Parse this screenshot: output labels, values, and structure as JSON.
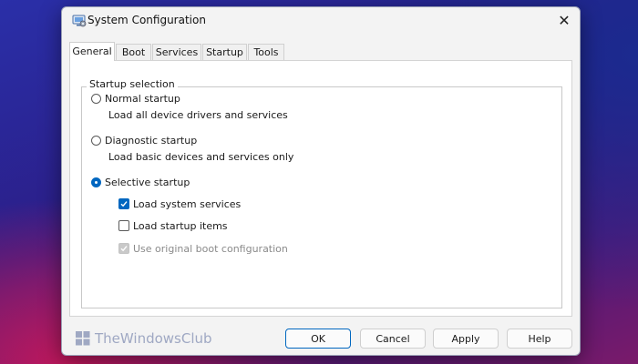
{
  "window": {
    "title": "System Configuration",
    "close_glyph": "✕"
  },
  "tabs": [
    {
      "label": "General",
      "active": true
    },
    {
      "label": "Boot",
      "active": false
    },
    {
      "label": "Services",
      "active": false
    },
    {
      "label": "Startup",
      "active": false
    },
    {
      "label": "Tools",
      "active": false
    }
  ],
  "startup_selection": {
    "group_label": "Startup selection",
    "normal": {
      "label": "Normal startup",
      "description": "Load all device drivers and services",
      "selected": false
    },
    "diagnostic": {
      "label": "Diagnostic startup",
      "description": "Load basic devices and services only",
      "selected": false
    },
    "selective": {
      "label": "Selective startup",
      "selected": true,
      "options": {
        "load_system_services": {
          "label": "Load system services",
          "checked": true,
          "enabled": true
        },
        "load_startup_items": {
          "label": "Load startup items",
          "checked": false,
          "enabled": true
        },
        "use_original_boot": {
          "label": "Use original boot configuration",
          "checked": true,
          "enabled": false
        }
      }
    }
  },
  "buttons": {
    "ok": "OK",
    "cancel": "Cancel",
    "apply": "Apply",
    "help": "Help"
  },
  "watermark": {
    "text": "TheWindowsClub"
  },
  "colors": {
    "accent": "#0067c0",
    "window_bg": "#f3f3f3",
    "panel_bg": "#ffffff"
  }
}
